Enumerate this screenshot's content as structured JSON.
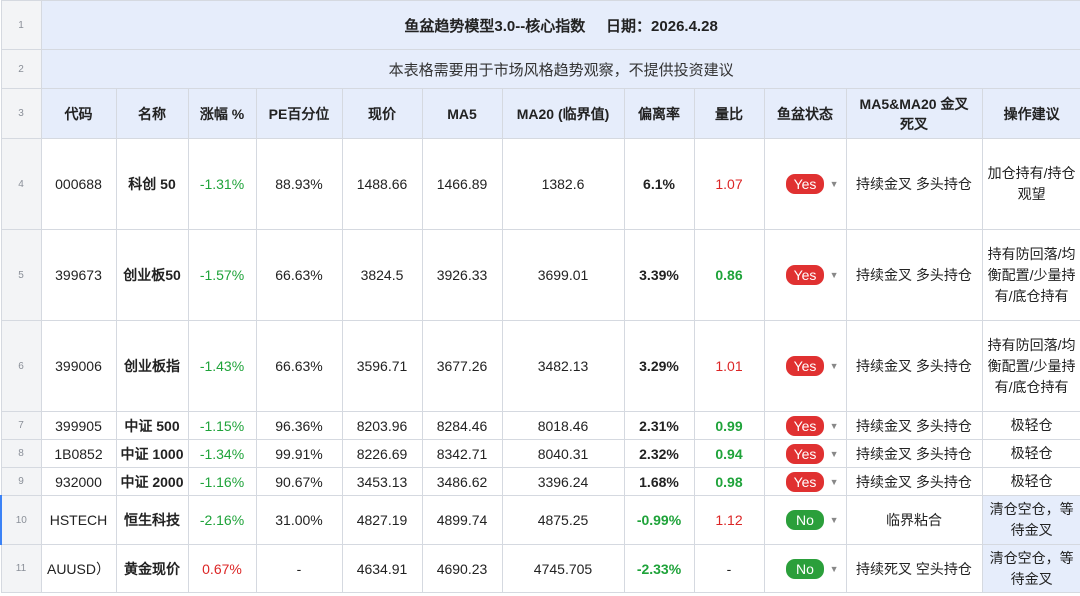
{
  "title": "鱼盆趋势模型3.0--核心指数     日期：2026.4.28",
  "subtitle": "本表格需要用于市场风格趋势观察，不提供投资建议",
  "row_numbers": [
    "1",
    "2",
    "3",
    "4",
    "5",
    "6",
    "7",
    "8",
    "9",
    "10",
    "11"
  ],
  "headers": {
    "code": "代码",
    "name": "名称",
    "change": "涨幅 %",
    "pe": "PE百分位",
    "price": "现价",
    "ma5": "MA5",
    "ma20": "MA20 (临界值)",
    "deviation": "偏离率",
    "volume_ratio": "量比",
    "status": "鱼盆状态",
    "cross": "MA5&MA20 金叉死叉",
    "advice": "操作建议"
  },
  "rows": [
    {
      "code": "000688",
      "name": "科创 50",
      "change": "-1.31%",
      "pe": "88.93%",
      "price": "1488.66",
      "ma5": "1466.89",
      "ma20": "1382.6",
      "deviation": "6.1%",
      "volume_ratio": "1.07",
      "status": "Yes",
      "cross": "持续金叉 多头持仓",
      "advice": "加仓持有/持仓观望"
    },
    {
      "code": "399673",
      "name": "创业板50",
      "change": "-1.57%",
      "pe": "66.63%",
      "price": "3824.5",
      "ma5": "3926.33",
      "ma20": "3699.01",
      "deviation": "3.39%",
      "volume_ratio": "0.86",
      "status": "Yes",
      "cross": "持续金叉 多头持仓",
      "advice": "持有防回落/均衡配置/少量持有/底仓持有"
    },
    {
      "code": "399006",
      "name": "创业板指",
      "change": "-1.43%",
      "pe": "66.63%",
      "price": "3596.71",
      "ma5": "3677.26",
      "ma20": "3482.13",
      "deviation": "3.29%",
      "volume_ratio": "1.01",
      "status": "Yes",
      "cross": "持续金叉 多头持仓",
      "advice": "持有防回落/均衡配置/少量持有/底仓持有"
    },
    {
      "code": "399905",
      "name": "中证 500",
      "change": "-1.15%",
      "pe": "96.36%",
      "price": "8203.96",
      "ma5": "8284.46",
      "ma20": "8018.46",
      "deviation": "2.31%",
      "volume_ratio": "0.99",
      "status": "Yes",
      "cross": "持续金叉 多头持仓",
      "advice": "极轻仓"
    },
    {
      "code": "1B0852",
      "name": "中证 1000",
      "change": "-1.34%",
      "pe": "99.91%",
      "price": "8226.69",
      "ma5": "8342.71",
      "ma20": "8040.31",
      "deviation": "2.32%",
      "volume_ratio": "0.94",
      "status": "Yes",
      "cross": "持续金叉 多头持仓",
      "advice": "极轻仓"
    },
    {
      "code": "932000",
      "name": "中证 2000",
      "change": "-1.16%",
      "pe": "90.67%",
      "price": "3453.13",
      "ma5": "3486.62",
      "ma20": "3396.24",
      "deviation": "1.68%",
      "volume_ratio": "0.98",
      "status": "Yes",
      "cross": "持续金叉 多头持仓",
      "advice": "极轻仓"
    },
    {
      "code": "HSTECH",
      "name": "恒生科技",
      "change": "-2.16%",
      "pe": "31.00%",
      "price": "4827.19",
      "ma5": "4899.74",
      "ma20": "4875.25",
      "deviation": "-0.99%",
      "volume_ratio": "1.12",
      "status": "No",
      "cross": "临界粘合",
      "advice": "清仓空仓，等待金叉"
    },
    {
      "code": "AUUSD）",
      "name": "黄金现价",
      "change": "0.67%",
      "pe": "-",
      "price": "4634.91",
      "ma5": "4690.23",
      "ma20": "4745.705",
      "deviation": "-2.33%",
      "volume_ratio": "-",
      "status": "No",
      "cross": "持续死叉 空头持仓",
      "advice": "清仓空仓，等待金叉"
    }
  ],
  "colors": {
    "header_bg": "#e6edfb",
    "yes": "#e03131",
    "no": "#2b9f3b",
    "up_green": "#1fa33a",
    "red": "#dc2626"
  },
  "icons": {
    "dropdown": "chevron-down-icon"
  }
}
